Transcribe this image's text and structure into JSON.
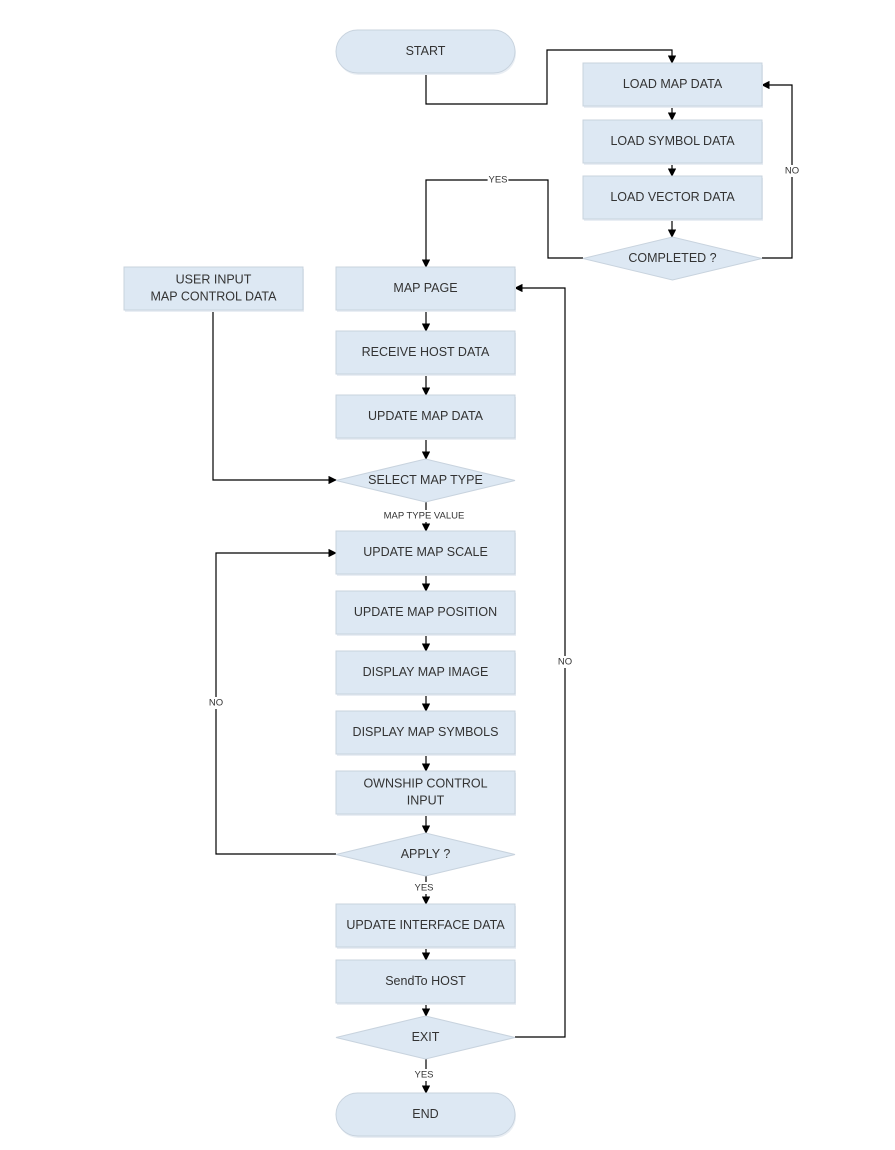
{
  "diagram": {
    "type": "flowchart",
    "nodes": [
      {
        "id": "start",
        "shape": "terminal",
        "lines": [
          "START"
        ]
      },
      {
        "id": "load_map",
        "shape": "process",
        "lines": [
          "LOAD MAP DATA"
        ]
      },
      {
        "id": "load_symbol",
        "shape": "process",
        "lines": [
          "LOAD SYMBOL DATA"
        ]
      },
      {
        "id": "load_vector",
        "shape": "process",
        "lines": [
          "LOAD VECTOR DATA"
        ]
      },
      {
        "id": "completed",
        "shape": "decision",
        "lines": [
          "COMPLETED ?"
        ]
      },
      {
        "id": "user_input",
        "shape": "process",
        "lines": [
          "USER INPUT",
          "MAP CONTROL DATA"
        ]
      },
      {
        "id": "map_page",
        "shape": "process",
        "lines": [
          "MAP PAGE"
        ]
      },
      {
        "id": "receive_host",
        "shape": "process",
        "lines": [
          "RECEIVE HOST DATA"
        ]
      },
      {
        "id": "update_map_data",
        "shape": "process",
        "lines": [
          "UPDATE MAP DATA"
        ]
      },
      {
        "id": "select_map_type",
        "shape": "decision",
        "lines": [
          "SELECT MAP TYPE"
        ]
      },
      {
        "id": "update_scale",
        "shape": "process",
        "lines": [
          "UPDATE MAP SCALE"
        ]
      },
      {
        "id": "update_position",
        "shape": "process",
        "lines": [
          "UPDATE MAP POSITION"
        ]
      },
      {
        "id": "display_image",
        "shape": "process",
        "lines": [
          "DISPLAY MAP IMAGE"
        ]
      },
      {
        "id": "display_symbols",
        "shape": "process",
        "lines": [
          "DISPLAY MAP SYMBOLS"
        ]
      },
      {
        "id": "ownship",
        "shape": "process",
        "lines": [
          "OWNSHIP CONTROL",
          "INPUT"
        ]
      },
      {
        "id": "apply",
        "shape": "decision",
        "lines": [
          "APPLY ?"
        ]
      },
      {
        "id": "update_interface",
        "shape": "process",
        "lines": [
          "UPDATE INTERFACE DATA"
        ]
      },
      {
        "id": "send_host",
        "shape": "process",
        "lines": [
          "SendTo HOST"
        ]
      },
      {
        "id": "exit",
        "shape": "decision",
        "lines": [
          "EXIT"
        ]
      },
      {
        "id": "end",
        "shape": "terminal",
        "lines": [
          "END"
        ]
      }
    ],
    "edges": [
      {
        "from": "start",
        "to": "load_map",
        "label": ""
      },
      {
        "from": "load_map",
        "to": "load_symbol",
        "label": ""
      },
      {
        "from": "load_symbol",
        "to": "load_vector",
        "label": ""
      },
      {
        "from": "load_vector",
        "to": "completed",
        "label": ""
      },
      {
        "from": "completed",
        "to": "load_map",
        "label": "NO"
      },
      {
        "from": "completed",
        "to": "map_page",
        "label": "YES"
      },
      {
        "from": "map_page",
        "to": "receive_host",
        "label": ""
      },
      {
        "from": "receive_host",
        "to": "update_map_data",
        "label": ""
      },
      {
        "from": "update_map_data",
        "to": "select_map_type",
        "label": ""
      },
      {
        "from": "user_input",
        "to": "select_map_type",
        "label": ""
      },
      {
        "from": "select_map_type",
        "to": "update_scale",
        "label": "MAP TYPE VALUE"
      },
      {
        "from": "update_scale",
        "to": "update_position",
        "label": ""
      },
      {
        "from": "update_position",
        "to": "display_image",
        "label": ""
      },
      {
        "from": "display_image",
        "to": "display_symbols",
        "label": ""
      },
      {
        "from": "display_symbols",
        "to": "ownship",
        "label": ""
      },
      {
        "from": "ownship",
        "to": "apply",
        "label": ""
      },
      {
        "from": "apply",
        "to": "update_scale",
        "label": "NO"
      },
      {
        "from": "apply",
        "to": "update_interface",
        "label": "YES"
      },
      {
        "from": "update_interface",
        "to": "send_host",
        "label": ""
      },
      {
        "from": "send_host",
        "to": "exit",
        "label": ""
      },
      {
        "from": "exit",
        "to": "map_page",
        "label": "NO"
      },
      {
        "from": "exit",
        "to": "end",
        "label": "YES"
      }
    ]
  }
}
